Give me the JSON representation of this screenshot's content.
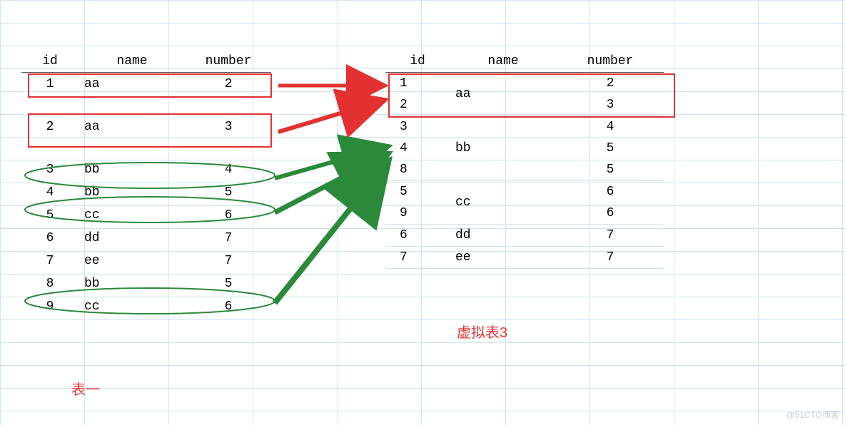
{
  "headers": {
    "id": "id",
    "name": "name",
    "number": "number"
  },
  "table1": {
    "label": "表一",
    "rows": [
      {
        "id": "1",
        "name": "aa",
        "number": "2"
      },
      {
        "id": "2",
        "name": "aa",
        "number": "3"
      },
      {
        "id": "3",
        "name": "bb",
        "number": "4"
      },
      {
        "id": "4",
        "name": "bb",
        "number": "5"
      },
      {
        "id": "5",
        "name": "cc",
        "number": "6"
      },
      {
        "id": "6",
        "name": "dd",
        "number": "7"
      },
      {
        "id": "7",
        "name": "ee",
        "number": "7"
      },
      {
        "id": "8",
        "name": "bb",
        "number": "5"
      },
      {
        "id": "9",
        "name": "cc",
        "number": "6"
      }
    ]
  },
  "table2": {
    "label": "虚拟表3",
    "groups": [
      {
        "name": "aa",
        "items": [
          {
            "id": "1",
            "number": "2"
          },
          {
            "id": "2",
            "number": "3"
          }
        ]
      },
      {
        "name": "bb",
        "items": [
          {
            "id": "3",
            "number": "4"
          },
          {
            "id": "4",
            "number": "5"
          },
          {
            "id": "8",
            "number": "5"
          }
        ]
      },
      {
        "name": "cc",
        "items": [
          {
            "id": "5",
            "number": "6"
          },
          {
            "id": "9",
            "number": "6"
          }
        ]
      },
      {
        "name": "dd",
        "items": [
          {
            "id": "6",
            "number": "7"
          }
        ]
      },
      {
        "name": "ee",
        "items": [
          {
            "id": "7",
            "number": "7"
          }
        ]
      }
    ]
  },
  "watermark": "@51CTO博客",
  "colors": {
    "red": "#e33030",
    "green": "#2a8a3a"
  },
  "chart_data": {
    "type": "table",
    "description": "Diagram showing GROUP BY transformation: left table rows grouped by 'name' column into right virtual table",
    "source_table": [
      {
        "id": 1,
        "name": "aa",
        "number": 2
      },
      {
        "id": 2,
        "name": "aa",
        "number": 3
      },
      {
        "id": 3,
        "name": "bb",
        "number": 4
      },
      {
        "id": 4,
        "name": "bb",
        "number": 5
      },
      {
        "id": 5,
        "name": "cc",
        "number": 6
      },
      {
        "id": 6,
        "name": "dd",
        "number": 7
      },
      {
        "id": 7,
        "name": "ee",
        "number": 7
      },
      {
        "id": 8,
        "name": "bb",
        "number": 5
      },
      {
        "id": 9,
        "name": "cc",
        "number": 6
      }
    ],
    "grouped_table": [
      {
        "name": "aa",
        "ids": [
          1,
          2
        ],
        "numbers": [
          2,
          3
        ]
      },
      {
        "name": "bb",
        "ids": [
          3,
          4,
          8
        ],
        "numbers": [
          4,
          5,
          5
        ]
      },
      {
        "name": "cc",
        "ids": [
          5,
          9
        ],
        "numbers": [
          6,
          6
        ]
      },
      {
        "name": "dd",
        "ids": [
          6
        ],
        "numbers": [
          7
        ]
      },
      {
        "name": "ee",
        "ids": [
          7
        ],
        "numbers": [
          7
        ]
      }
    ],
    "arrow_mappings": [
      {
        "from_rows": [
          1,
          2
        ],
        "to_group": "aa",
        "color": "red"
      },
      {
        "from_rows": [
          3,
          4,
          8
        ],
        "to_group": "bb",
        "color": "green"
      }
    ]
  }
}
